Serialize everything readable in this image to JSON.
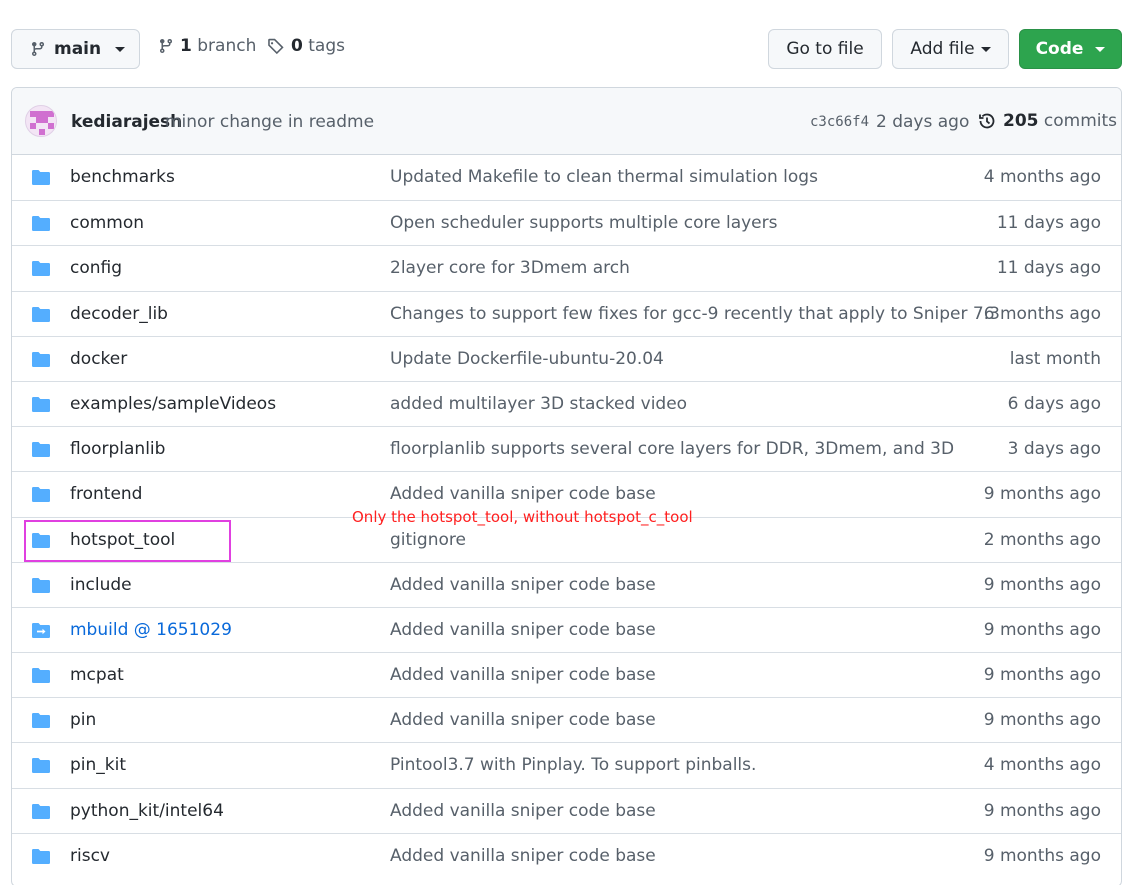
{
  "toolbar": {
    "branch_name": "main",
    "branch_count": "1",
    "branch_label": "branch",
    "tag_count": "0",
    "tag_label": "tags",
    "goto_label": "Go to file",
    "addfile_label": "Add file",
    "code_label": "Code"
  },
  "commit": {
    "author": "kediarajesh",
    "message": "minor change in readme",
    "sha": "c3c66f4",
    "time": "2 days ago",
    "count": "205",
    "count_label": "commits"
  },
  "files": [
    {
      "name": "benchmarks",
      "message": "Updated Makefile to clean thermal simulation logs",
      "time": "4 months ago",
      "type": "folder"
    },
    {
      "name": "common",
      "message": "Open scheduler supports multiple core layers",
      "time": "11 days ago",
      "type": "folder"
    },
    {
      "name": "config",
      "message": "2layer core for 3Dmem arch",
      "time": "11 days ago",
      "type": "folder"
    },
    {
      "name": "decoder_lib",
      "message": "Changes to support few fixes for gcc-9 recently that apply to Sniper 7.3",
      "time": "6 months ago",
      "type": "folder"
    },
    {
      "name": "docker",
      "message": "Update Dockerfile-ubuntu-20.04",
      "time": "last month",
      "type": "folder"
    },
    {
      "name": "examples/sampleVideos",
      "message": "added multilayer 3D stacked video",
      "time": "6 days ago",
      "type": "folder"
    },
    {
      "name": "floorplanlib",
      "message": "floorplanlib supports several core layers for DDR, 3Dmem, and 3D",
      "time": "3 days ago",
      "type": "folder"
    },
    {
      "name": "frontend",
      "message": "Added vanilla sniper code base",
      "time": "9 months ago",
      "type": "folder"
    },
    {
      "name": "hotspot_tool",
      "message": "gitignore",
      "time": "2 months ago",
      "type": "folder"
    },
    {
      "name": "include",
      "message": "Added vanilla sniper code base",
      "time": "9 months ago",
      "type": "folder"
    },
    {
      "name": "mbuild @ 1651029",
      "message": "Added vanilla sniper code base",
      "time": "9 months ago",
      "type": "submodule"
    },
    {
      "name": "mcpat",
      "message": "Added vanilla sniper code base",
      "time": "9 months ago",
      "type": "folder"
    },
    {
      "name": "pin",
      "message": "Added vanilla sniper code base",
      "time": "9 months ago",
      "type": "folder"
    },
    {
      "name": "pin_kit",
      "message": "Pintool3.7 with Pinplay. To support pinballs.",
      "time": "4 months ago",
      "type": "folder"
    },
    {
      "name": "python_kit/intel64",
      "message": "Added vanilla sniper code base",
      "time": "9 months ago",
      "type": "folder"
    },
    {
      "name": "riscv",
      "message": "Added vanilla sniper code base",
      "time": "9 months ago",
      "type": "folder"
    }
  ],
  "annotation": {
    "text": "Only the hotspot_tool, without hotspot_c_tool",
    "color": "#ff2020",
    "box_color": "#e040e0"
  },
  "colors": {
    "folder": "#54aeff",
    "code_button": "#2da44e",
    "link": "#0969da"
  }
}
